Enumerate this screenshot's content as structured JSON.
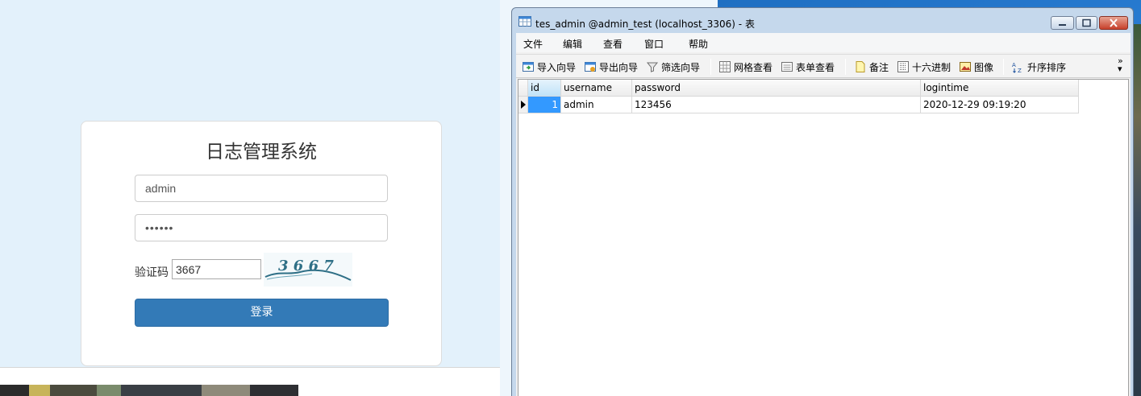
{
  "login": {
    "title": "日志管理系统",
    "username_value": "admin",
    "password_value": "••••••",
    "captcha_label": "验证码",
    "captcha_value": "3667",
    "captcha_image_text": "3 6 6 7",
    "submit_label": "登录"
  },
  "window": {
    "title": "tes_admin @admin_test (localhost_3306) - 表",
    "menu": [
      "文件",
      "编辑",
      "查看",
      "窗口",
      "帮助"
    ],
    "toolbar": {
      "import_wizard": "导入向导",
      "export_wizard": "导出向导",
      "filter_wizard": "筛选向导",
      "grid_view": "网格查看",
      "form_view": "表单查看",
      "memo": "备注",
      "hex": "十六进制",
      "image": "图像",
      "sort_asc": "升序排序"
    },
    "table": {
      "columns": [
        "id",
        "username",
        "password",
        "logintime"
      ],
      "rows": [
        {
          "id": "1",
          "username": "admin",
          "password": "123456",
          "logintime": "2020-12-29 09:19:20"
        }
      ]
    }
  },
  "colors": {
    "login_button": "#337ab7",
    "selected_cell": "#3399ff",
    "page_background": "#e3f1fb",
    "close_button": "#c7402b"
  }
}
